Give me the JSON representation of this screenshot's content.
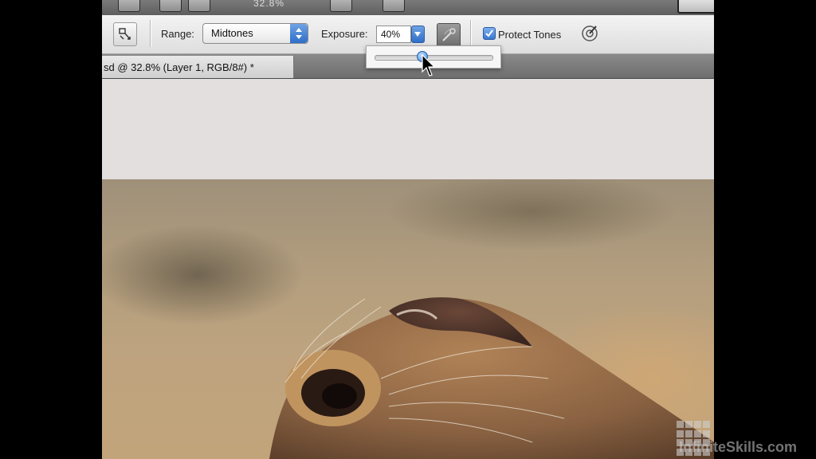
{
  "app": {
    "zoom_readout": "32.8%"
  },
  "options_bar": {
    "range_label": "Range:",
    "range_value": "Midtones",
    "exposure_label": "Exposure:",
    "exposure_value": "40%",
    "protect_tones_label": "Protect Tones",
    "protect_tones_checked": true
  },
  "exposure_slider": {
    "value_percent": 40
  },
  "document_tab": {
    "title": "sd @ 32.8% (Layer 1, RGB/8#) *"
  },
  "watermark": {
    "text": "InfiniteSkills.com"
  },
  "colors": {
    "accent_blue": "#3a78d0",
    "canvas_bg": "#e2dfde"
  },
  "icons": [
    "tool-preset-icon",
    "stepper-arrows-icon",
    "dropdown-arrow-icon",
    "airbrush-icon",
    "checkmark-icon",
    "pressure-size-icon",
    "mouse-cursor-icon"
  ]
}
